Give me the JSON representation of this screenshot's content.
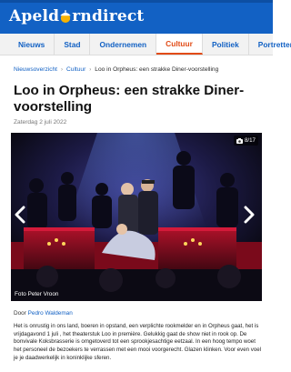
{
  "site": {
    "logo_left": "Apeld",
    "logo_right": "rndirect",
    "logo_mark": "acorn-icon"
  },
  "nav": {
    "items": [
      {
        "label": "Nieuws",
        "active": false
      },
      {
        "label": "Stad",
        "active": false
      },
      {
        "label": "Ondernemen",
        "active": false
      },
      {
        "label": "Cultuur",
        "active": true
      },
      {
        "label": "Politiek",
        "active": false
      },
      {
        "label": "Portretten",
        "active": false
      }
    ]
  },
  "breadcrumb": {
    "items": [
      "Nieuwsoverzicht",
      "Cultuur",
      "Loo in Orpheus: een strakke Diner-voorstelling"
    ],
    "separator": "›"
  },
  "article": {
    "title": "Loo in Orpheus: een strakke Diner-voorstelling",
    "date": "Zaterdag 2 juli 2022",
    "photo": {
      "counter": "8/17",
      "counter_icon": "camera-icon",
      "prev_icon": "chevron-left-icon",
      "next_icon": "chevron-right-icon",
      "credit": "Foto Peter Vroon"
    },
    "byline_prefix": "Door",
    "author": "Pedro Waldeman",
    "body": "Het is onrustig in ons land, boeren in opstand, een verplichte rookmelder en in Orpheus gaat, het is vrijdagavond 1 juli , het theaterstuk Loo in première. Gelukkig gaat de show niet in rook op. De bonvivale Koksbrasserie is omgetoverd tot een sprookjesachtige eetzaal. In een hoog tempo woet het personeel de bezoekers te verrassen met een mooi voorgerecht. Glazen klinken. Voor even voel je je daadwerkelijk in koninklijke sferen."
  },
  "colors": {
    "brand_blue": "#1261c4",
    "accent_orange": "#e14b16",
    "nav_bg": "#f2f2f2"
  }
}
